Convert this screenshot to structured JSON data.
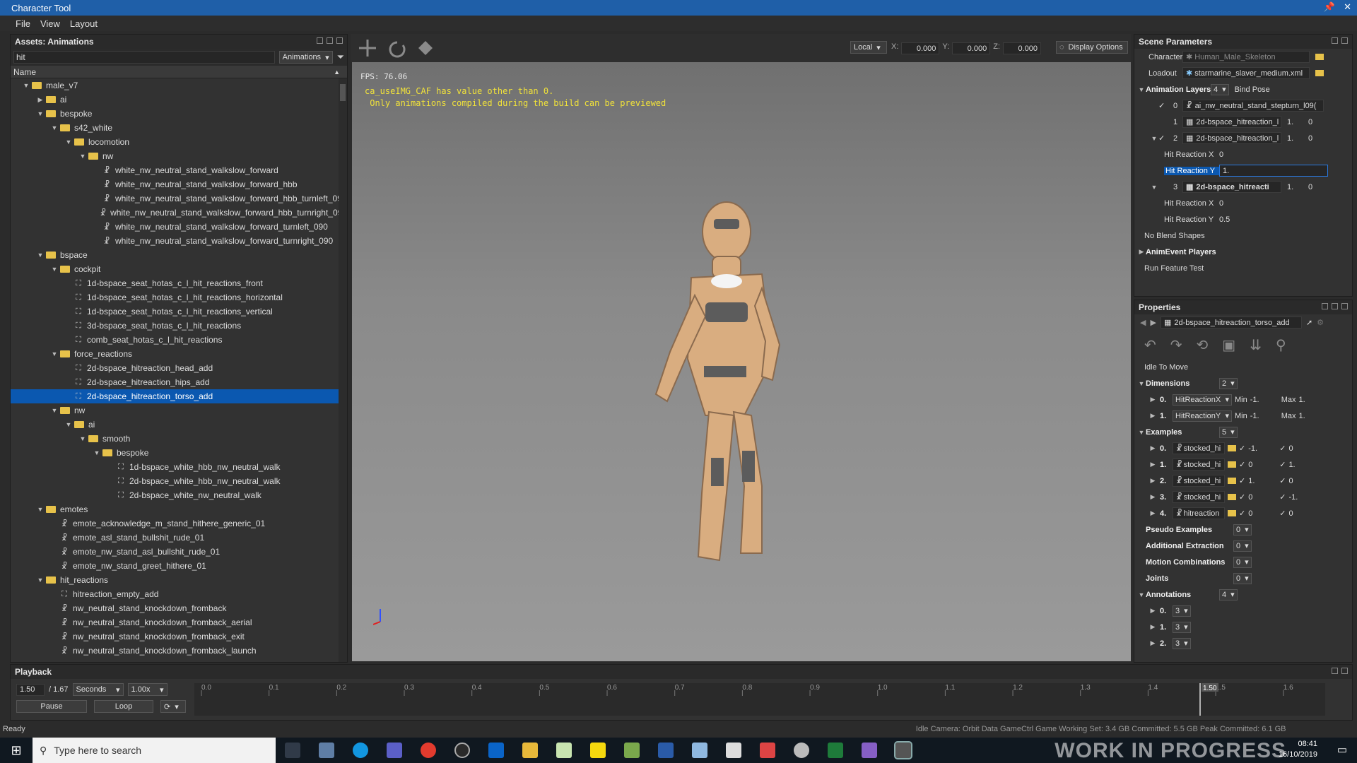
{
  "window": {
    "title": "Character Tool"
  },
  "menu": [
    "File",
    "View",
    "Layout"
  ],
  "assets": {
    "title": "Assets: Animations",
    "search_value": "hit",
    "filter_type": "Animations",
    "column_name": "Name",
    "rows": [
      {
        "label": "male_v7",
        "depth": 1,
        "kind": "folder",
        "expanded": true
      },
      {
        "label": "ai",
        "depth": 2,
        "kind": "folder",
        "expanded": false
      },
      {
        "label": "bespoke",
        "depth": 2,
        "kind": "folder",
        "expanded": true
      },
      {
        "label": "s42_white",
        "depth": 3,
        "kind": "folder",
        "expanded": true
      },
      {
        "label": "locomotion",
        "depth": 4,
        "kind": "folder",
        "expanded": true
      },
      {
        "label": "nw",
        "depth": 5,
        "kind": "folder",
        "expanded": true
      },
      {
        "label": "white_nw_neutral_stand_walkslow_forward",
        "depth": 6,
        "kind": "anim"
      },
      {
        "label": "white_nw_neutral_stand_walkslow_forward_hbb",
        "depth": 6,
        "kind": "anim"
      },
      {
        "label": "white_nw_neutral_stand_walkslow_forward_hbb_turnleft_090",
        "depth": 6,
        "kind": "anim"
      },
      {
        "label": "white_nw_neutral_stand_walkslow_forward_hbb_turnright_090",
        "depth": 6,
        "kind": "anim"
      },
      {
        "label": "white_nw_neutral_stand_walkslow_forward_turnleft_090",
        "depth": 6,
        "kind": "anim"
      },
      {
        "label": "white_nw_neutral_stand_walkslow_forward_turnright_090",
        "depth": 6,
        "kind": "anim"
      },
      {
        "label": "bspace",
        "depth": 2,
        "kind": "folder",
        "expanded": true
      },
      {
        "label": "cockpit",
        "depth": 3,
        "kind": "folder",
        "expanded": true
      },
      {
        "label": "1d-bspace_seat_hotas_c_l_hit_reactions_front",
        "depth": 4,
        "kind": "bspace"
      },
      {
        "label": "1d-bspace_seat_hotas_c_l_hit_reactions_horizontal",
        "depth": 4,
        "kind": "bspace"
      },
      {
        "label": "1d-bspace_seat_hotas_c_l_hit_reactions_vertical",
        "depth": 4,
        "kind": "bspace"
      },
      {
        "label": "3d-bspace_seat_hotas_c_l_hit_reactions",
        "depth": 4,
        "kind": "bspace"
      },
      {
        "label": "comb_seat_hotas_c_l_hit_reactions",
        "depth": 4,
        "kind": "bspace"
      },
      {
        "label": "force_reactions",
        "depth": 3,
        "kind": "folder",
        "expanded": true
      },
      {
        "label": "2d-bspace_hitreaction_head_add",
        "depth": 4,
        "kind": "bspace"
      },
      {
        "label": "2d-bspace_hitreaction_hips_add",
        "depth": 4,
        "kind": "bspace"
      },
      {
        "label": "2d-bspace_hitreaction_torso_add",
        "depth": 4,
        "kind": "bspace",
        "selected": true
      },
      {
        "label": "nw",
        "depth": 3,
        "kind": "folder",
        "expanded": true
      },
      {
        "label": "ai",
        "depth": 4,
        "kind": "folder",
        "expanded": true
      },
      {
        "label": "smooth",
        "depth": 5,
        "kind": "folder",
        "expanded": true
      },
      {
        "label": "bespoke",
        "depth": 6,
        "kind": "folder",
        "expanded": true
      },
      {
        "label": "1d-bspace_white_hbb_nw_neutral_walk",
        "depth": 7,
        "kind": "bspace"
      },
      {
        "label": "2d-bspace_white_hbb_nw_neutral_walk",
        "depth": 7,
        "kind": "bspace"
      },
      {
        "label": "2d-bspace_white_nw_neutral_walk",
        "depth": 7,
        "kind": "bspace"
      },
      {
        "label": "emotes",
        "depth": 2,
        "kind": "folder",
        "expanded": true
      },
      {
        "label": "emote_acknowledge_m_stand_hithere_generic_01",
        "depth": 3,
        "kind": "anim"
      },
      {
        "label": "emote_asl_stand_bullshit_rude_01",
        "depth": 3,
        "kind": "anim"
      },
      {
        "label": "emote_nw_stand_asl_bullshit_rude_01",
        "depth": 3,
        "kind": "anim"
      },
      {
        "label": "emote_nw_stand_greet_hithere_01",
        "depth": 3,
        "kind": "anim"
      },
      {
        "label": "hit_reactions",
        "depth": 2,
        "kind": "folder",
        "expanded": true
      },
      {
        "label": "hitreaction_empty_add",
        "depth": 3,
        "kind": "bspace"
      },
      {
        "label": "nw_neutral_stand_knockdown_fromback",
        "depth": 3,
        "kind": "anim"
      },
      {
        "label": "nw_neutral_stand_knockdown_fromback_aerial",
        "depth": 3,
        "kind": "anim"
      },
      {
        "label": "nw_neutral_stand_knockdown_fromback_exit",
        "depth": 3,
        "kind": "anim"
      },
      {
        "label": "nw_neutral_stand_knockdown_fromback_launch",
        "depth": 3,
        "kind": "anim"
      }
    ]
  },
  "viewport_toolbar": {
    "space": "Local",
    "x_label": "X:",
    "x": "0.000",
    "y_label": "Y:",
    "y": "0.000",
    "z_label": "Z:",
    "z": "0.000",
    "display_options": "Display Options"
  },
  "viewport": {
    "fps": "FPS: 76.06",
    "warning_line1": "ca_useIMG_CAF has value other than 0.",
    "warning_line2": " Only animations compiled during the build can be previewed"
  },
  "scene": {
    "title": "Scene Parameters",
    "character_label": "Character",
    "character_value": "Human_Male_Skeleton",
    "loadout_label": "Loadout",
    "loadout_value": "starmarine_slaver_medium.xml",
    "anim_layers_label": "Animation Layers",
    "anim_layers_count": "4",
    "bind_pose": "Bind Pose",
    "layers": [
      {
        "index": "0",
        "name": "ai_nw_neutral_stand_stepturn_l09(",
        "w": "",
        "v": ""
      },
      {
        "index": "1",
        "name": "2d-bspace_hitreaction_l",
        "w": "1.",
        "v": "0"
      },
      {
        "index": "2",
        "name": "2d-bspace_hitreaction_l",
        "w": "1.",
        "v": "0"
      },
      {
        "index": "3",
        "name": "2d-bspace_hitreacti",
        "w": "1.",
        "v": "0"
      }
    ],
    "l2_hrx_label": "Hit Reaction X",
    "l2_hrx": "0",
    "l2_hry_label": "Hit Reaction Y",
    "l2_hry": "1.",
    "l3_hrx_label": "Hit Reaction X",
    "l3_hrx": "0",
    "l3_hry_label": "Hit Reaction Y",
    "l3_hry": "0.5",
    "no_blend": "No Blend Shapes",
    "anim_event": "AnimEvent Players",
    "run_test": "Run Feature Test"
  },
  "props": {
    "title": "Properties",
    "current": "2d-bspace_hitreaction_torso_add",
    "idle_to_move": "Idle To Move",
    "dimensions_label": "Dimensions",
    "dimensions_count": "2",
    "dims": [
      {
        "i": "0.",
        "param": "HitReactionX",
        "min_label": "Min",
        "min": "-1.",
        "max_label": "Max",
        "max": "1."
      },
      {
        "i": "1.",
        "param": "HitReactionY",
        "min_label": "Min",
        "min": "-1.",
        "max_label": "Max",
        "max": "1."
      }
    ],
    "examples_label": "Examples",
    "examples_count": "5",
    "examples": [
      {
        "i": "0.",
        "name": "stocked_hi",
        "a": "-1.",
        "b": "0"
      },
      {
        "i": "1.",
        "name": "stocked_hi",
        "a": "0",
        "b": "1."
      },
      {
        "i": "2.",
        "name": "stocked_hi",
        "a": "1.",
        "b": "0"
      },
      {
        "i": "3.",
        "name": "stocked_hi",
        "a": "0",
        "b": "-1."
      },
      {
        "i": "4.",
        "name": "hitreaction",
        "a": "0",
        "b": "0"
      }
    ],
    "pseudo_label": "Pseudo Examples",
    "pseudo_count": "0",
    "addext_label": "Additional Extraction",
    "addext_count": "0",
    "motion_label": "Motion Combinations",
    "motion_count": "0",
    "joints_label": "Joints",
    "joints_count": "0",
    "annotations_label": "Annotations",
    "annotations_count": "4",
    "annotations": [
      {
        "i": "0.",
        "v": "3"
      },
      {
        "i": "1.",
        "v": "3"
      },
      {
        "i": "2.",
        "v": "3"
      }
    ]
  },
  "playback": {
    "title": "Playback",
    "time": "1.50",
    "total": "/ 1.67",
    "units": "Seconds",
    "speed": "1.00x",
    "pause": "Pause",
    "loop": "Loop",
    "ticks": [
      "0.0",
      "0.1",
      "0.2",
      "0.3",
      "0.4",
      "0.5",
      "0.6",
      "0.7",
      "0.8",
      "0.9",
      "1.0",
      "1.1",
      "1.2",
      "1.3",
      "1.4",
      "1.5",
      "1.6"
    ],
    "current_marker": "1.50",
    "current_position": 0.9
  },
  "status": {
    "left": "Ready",
    "right": "Idle   Camera: Orbit   Data   GameCtrl   Game   Working Set: 3.4 GB   Committed: 5.5 GB   Peak Committed: 6.1 GB"
  },
  "taskbar": {
    "search_placeholder": "Type here to search",
    "time": "08:41",
    "date": "16/10/2019",
    "watermark": "WORK IN PROGRESS"
  },
  "colors": {
    "accent": "#0b58b0",
    "titlebar": "#1f5fa8",
    "warning": "#f1e23a",
    "folder": "#e7c24a"
  }
}
